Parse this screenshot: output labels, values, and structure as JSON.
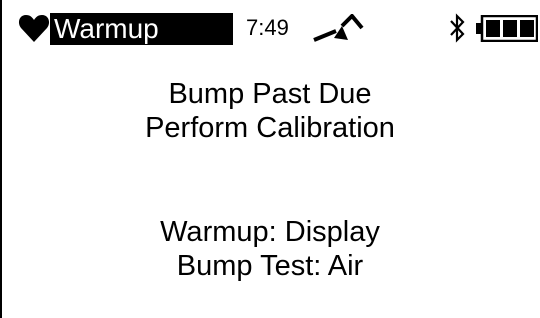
{
  "status_bar": {
    "mode": "Warmup",
    "time": "7:49",
    "icons": [
      "heart-icon",
      "pump-icon",
      "bluetooth-icon",
      "battery-icon"
    ],
    "battery_level": 1.0
  },
  "messages": {
    "line1": "Bump Past Due",
    "line2": "Perform Calibration",
    "line3": "Warmup: Display",
    "line4": "Bump Test: Air"
  }
}
